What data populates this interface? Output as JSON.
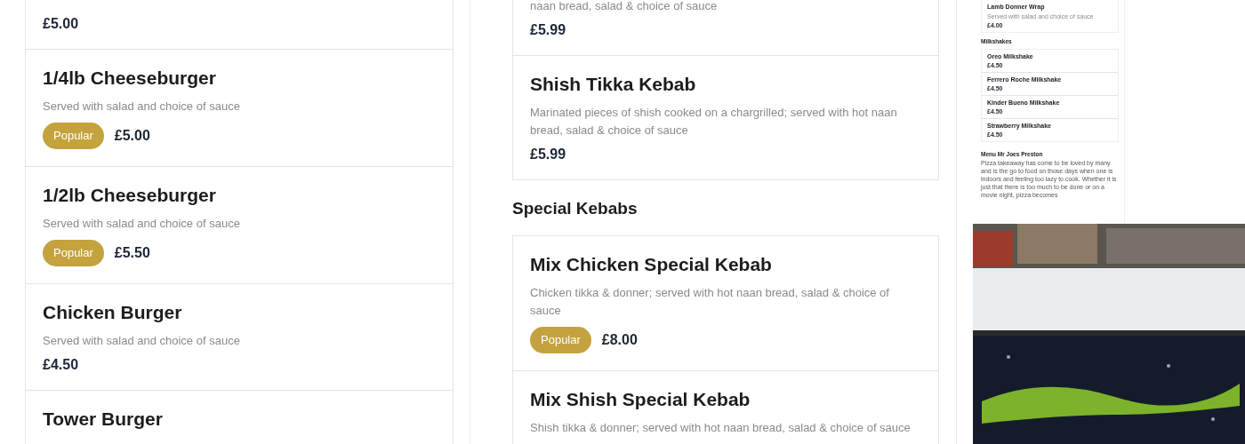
{
  "burgers": {
    "items": [
      {
        "price": "£5.00"
      },
      {
        "name": "1/4lb Cheeseburger",
        "description": "Served with salad and choice of sauce",
        "badge": "Popular",
        "price": "£5.00"
      },
      {
        "name": "1/2lb Cheeseburger",
        "description": "Served with salad and choice of sauce",
        "badge": "Popular",
        "price": "£5.50"
      },
      {
        "name": "Chicken Burger",
        "description": "Served with salad and choice of sauce",
        "price": "£4.50"
      },
      {
        "name": "Tower Burger"
      }
    ]
  },
  "kebabs": {
    "items": [
      {
        "description": "naan bread, salad & choice of sauce",
        "price": "£5.99"
      },
      {
        "name": "Shish Tikka Kebab",
        "description": "Marinated pieces of shish cooked on a chargrilled; served with hot naan bread, salad & choice of sauce",
        "price": "£5.99"
      }
    ]
  },
  "special_kebabs": {
    "heading": "Special Kebabs",
    "items": [
      {
        "name": "Mix Chicken Special Kebab",
        "description": "Chicken tikka & donner; served with hot naan bread, salad & choice of sauce",
        "badge": "Popular",
        "price": "£8.00"
      },
      {
        "name": "Mix Shish Special Kebab",
        "description": "Shish tikka & donner; served with hot naan bread, salad & choice of sauce"
      }
    ]
  },
  "sidebar": {
    "sections": [
      {
        "items": [
          {
            "name": "Lamb Donner Wrap",
            "description": "Served with salad and choice of sauce",
            "price": "£4.00"
          }
        ]
      },
      {
        "heading": "Milkshakes",
        "items": [
          {
            "name": "Oreo Milkshake",
            "price": "£4.50"
          },
          {
            "name": "Ferrero Roche Milkshake",
            "price": "£4.50"
          },
          {
            "name": "Kinder Bueno Milkshake",
            "price": "£4.50"
          },
          {
            "name": "Strawberry Milkshake",
            "price": "£4.50"
          }
        ]
      }
    ],
    "about_title": "Menu Mr Joes Preston",
    "about_text": "Pizza takeaway has come to be loved by many and is the go to food on those days when one is indoors and feeling too lazy to cook. Whether it is just that there is too much to be done or on a movie night, pizza becomes"
  }
}
